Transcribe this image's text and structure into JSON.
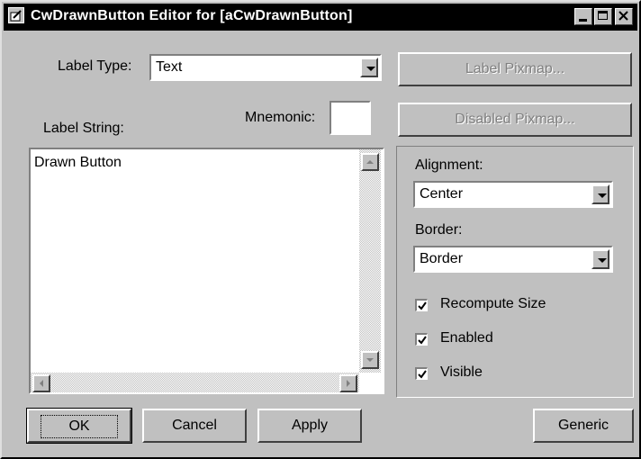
{
  "window": {
    "title": "CwDrawnButton Editor for [aCwDrawnButton]"
  },
  "label_type": {
    "label": "Label Type:",
    "value": "Text"
  },
  "buttons_top": {
    "label_pixmap": "Label Pixmap...",
    "disabled_pixmap": "Disabled Pixmap..."
  },
  "label_string": {
    "label": "Label String:",
    "text": "Drawn Button"
  },
  "mnemonic": {
    "label": "Mnemonic:",
    "value": ""
  },
  "alignment": {
    "label": "Alignment:",
    "value": "Center"
  },
  "border": {
    "label": "Border:",
    "value": "Border"
  },
  "options": [
    {
      "label": "Recompute Size",
      "checked": true
    },
    {
      "label": "Enabled",
      "checked": true
    },
    {
      "label": "Visible",
      "checked": true
    }
  ],
  "actions": {
    "ok": "OK",
    "cancel": "Cancel",
    "apply": "Apply",
    "generic": "Generic"
  }
}
